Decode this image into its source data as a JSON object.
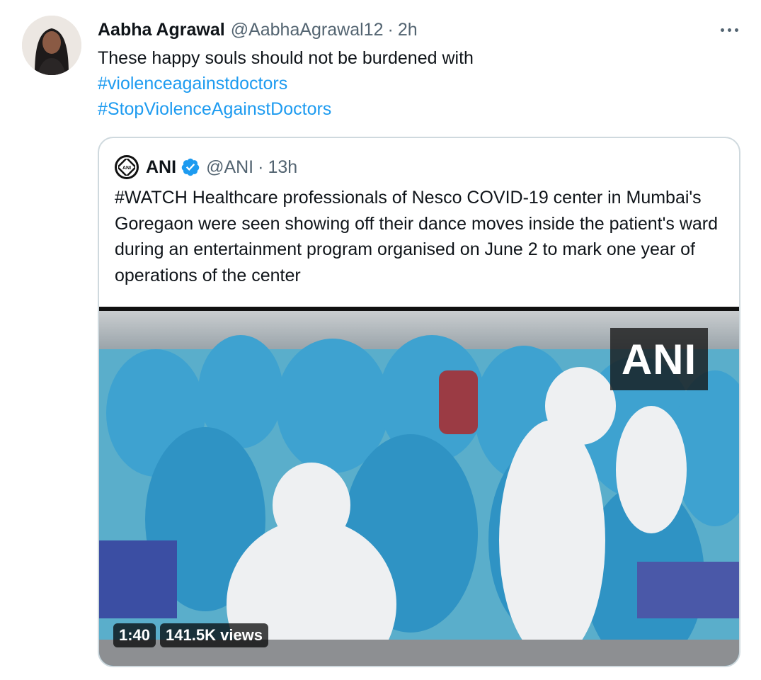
{
  "tweet": {
    "author_name": "Aabha Agrawal",
    "author_handle": "@AabhaAgrawal12",
    "separator": "·",
    "time": "2h",
    "text_line1": "These happy souls should not be burdened with",
    "hashtag1": "#violenceagainstdoctors",
    "hashtag2": "#StopViolenceAgainstDoctors"
  },
  "quote": {
    "author_name": "ANI",
    "author_handle": "@ANI",
    "separator": "·",
    "time": "13h",
    "verified": true,
    "text": "#WATCH Healthcare professionals of Nesco COVID-19 center in Mumbai's Goregaon were seen showing off their dance moves inside the patient's ward during an entertainment program organised on June 2 to mark one year of operations of the center",
    "media": {
      "watermark": "ANI",
      "duration": "1:40",
      "views": "141.5K views"
    }
  },
  "colors": {
    "link": "#1d9bf0",
    "secondary_text": "#536471",
    "border": "#cfd9de",
    "verified": "#1d9bf0"
  },
  "icons": [
    "more-icon",
    "verified-badge-icon"
  ]
}
